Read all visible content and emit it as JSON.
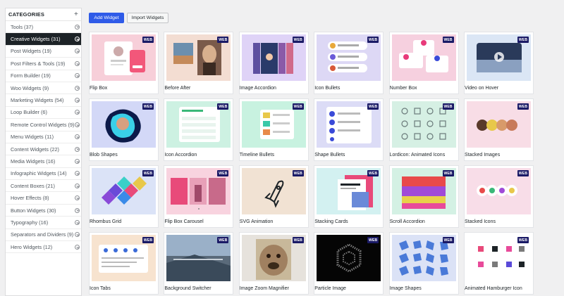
{
  "sidebar": {
    "title": "CATEGORIES",
    "add_glyph": "+",
    "items": [
      {
        "label": "Tools (37)",
        "active": false
      },
      {
        "label": "Creative Widgets (31)",
        "active": true
      },
      {
        "label": "Post Widgets (19)",
        "active": false
      },
      {
        "label": "Post Filters & Tools (19)",
        "active": false
      },
      {
        "label": "Form Builder (19)",
        "active": false
      },
      {
        "label": "Woo Widgets (9)",
        "active": false
      },
      {
        "label": "Marketing Widgets (54)",
        "active": false
      },
      {
        "label": "Loop Builder (6)",
        "active": false
      },
      {
        "label": "Remote Control Widgets (9)",
        "active": false
      },
      {
        "label": "Menu Widgets (11)",
        "active": false
      },
      {
        "label": "Content Widgets (22)",
        "active": false
      },
      {
        "label": "Media Widgets (16)",
        "active": false
      },
      {
        "label": "Infographic Widgets (14)",
        "active": false
      },
      {
        "label": "Content Boxes (21)",
        "active": false
      },
      {
        "label": "Hover Effects (8)",
        "active": false
      },
      {
        "label": "Button Widgets (30)",
        "active": false
      },
      {
        "label": "Typography (16)",
        "active": false
      },
      {
        "label": "Separators and Dividers (9)",
        "active": false
      },
      {
        "label": "Hero Widgets (12)",
        "active": false
      }
    ]
  },
  "toolbar": {
    "add_label": "Add Widget",
    "import_label": "Import Widgets"
  },
  "badge_text": "WEB",
  "colors": {
    "accent": "#2f5be8",
    "active_category": "#1d2327",
    "badge": "#1a1a66"
  },
  "widgets": [
    {
      "name": "Flip Box",
      "bg": "#f7cfd9",
      "icon": "flip-box-icon"
    },
    {
      "name": "Before After",
      "bg": "#f3ddd2",
      "icon": "before-after-icon"
    },
    {
      "name": "Image Accordion",
      "bg": "#dfd3f7",
      "icon": "image-accordion-icon"
    },
    {
      "name": "Icon Bullets",
      "bg": "#ddd8f5",
      "icon": "icon-bullets-icon"
    },
    {
      "name": "Number Box",
      "bg": "#f6d0df",
      "icon": "number-box-icon"
    },
    {
      "name": "Video on Hover",
      "bg": "#dbe6f5",
      "icon": "video-hover-icon"
    },
    {
      "name": "Blob Shapes",
      "bg": "#d3d8f7",
      "icon": "blob-shapes-icon"
    },
    {
      "name": "Icon Accordion",
      "bg": "#cdf1e2",
      "icon": "icon-accordion-icon"
    },
    {
      "name": "Timeline Bullets",
      "bg": "#c8f2e0",
      "icon": "timeline-bullets-icon"
    },
    {
      "name": "Shape Bullets",
      "bg": "#dcdcf6",
      "icon": "shape-bullets-icon"
    },
    {
      "name": "Lordicon: Animated Icons",
      "bg": "#d6f0e4",
      "icon": "lordicon-icon"
    },
    {
      "name": "Stacked Images",
      "bg": "#f8dde6",
      "icon": "stacked-images-icon"
    },
    {
      "name": "Rhombus Grid",
      "bg": "#dbe3f7",
      "icon": "rhombus-grid-icon"
    },
    {
      "name": "Flip Box Carousel",
      "bg": "#f8d3df",
      "icon": "flip-carousel-icon"
    },
    {
      "name": "SVG Animation",
      "bg": "#f1e2d3",
      "icon": "rocket-icon"
    },
    {
      "name": "Stacking Cards",
      "bg": "#d3f1f1",
      "icon": "stacking-cards-icon"
    },
    {
      "name": "Scroll Accordion",
      "bg": "#d4f1e4",
      "icon": "scroll-accordion-icon"
    },
    {
      "name": "Stacked Icons",
      "bg": "#f8dde8",
      "icon": "stacked-icons-icon"
    },
    {
      "name": "Icon Tabs",
      "bg": "#f7e3cf",
      "icon": "icon-tabs-icon"
    },
    {
      "name": "Background Switcher",
      "bg": "#d6dde8",
      "icon": "bg-switcher-icon"
    },
    {
      "name": "Image Zoom Magnifier",
      "bg": "#e6e2dc",
      "icon": "zoom-magnifier-icon"
    },
    {
      "name": "Particle Image",
      "bg": "#050505",
      "icon": "particle-image-icon"
    },
    {
      "name": "Image Shapes",
      "bg": "#dbe2f6",
      "icon": "image-shapes-icon"
    },
    {
      "name": "Animated Hamburger Icon",
      "bg": "#ffffff",
      "icon": "hamburger-icon"
    }
  ]
}
